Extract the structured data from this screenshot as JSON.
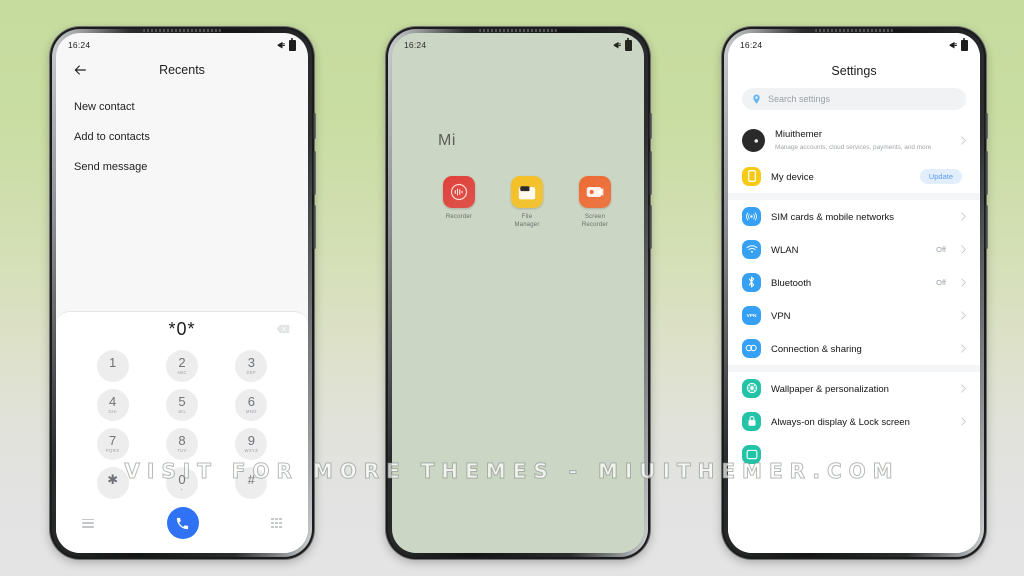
{
  "watermark": "VISIT FOR MORE THEMES - MIUITHEMER.COM",
  "status": {
    "time": "16:24"
  },
  "dialer": {
    "title": "Recents",
    "back_icon": "back-arrow-icon",
    "options": [
      "New contact",
      "Add to contacts",
      "Send message"
    ],
    "number": "*0*",
    "backspace_icon": "backspace-icon",
    "keys": [
      {
        "digit": "1",
        "letters": ""
      },
      {
        "digit": "2",
        "letters": "ABC"
      },
      {
        "digit": "3",
        "letters": "DEF"
      },
      {
        "digit": "4",
        "letters": "GHI"
      },
      {
        "digit": "5",
        "letters": "JKL"
      },
      {
        "digit": "6",
        "letters": "MNO"
      },
      {
        "digit": "7",
        "letters": "PQRS"
      },
      {
        "digit": "8",
        "letters": "TUV"
      },
      {
        "digit": "9",
        "letters": "WXYZ"
      },
      {
        "digit": "✱",
        "letters": ""
      },
      {
        "digit": "0",
        "letters": "+"
      },
      {
        "digit": "#",
        "letters": ""
      }
    ],
    "bottom": {
      "menu_icon": "menu-icon",
      "call_icon": "call-icon",
      "keypad_icon": "keypad-icon"
    },
    "call_color": "#2f72f3"
  },
  "home": {
    "folder_label": "Mi",
    "wallpaper_color": "#ccd6c5",
    "apps": [
      {
        "name": "Recorder",
        "color": "#e0403a"
      },
      {
        "name": "File\nManager",
        "color": "#f6c024"
      },
      {
        "name": "Screen\nRecorder",
        "color": "#ef6a33"
      }
    ]
  },
  "settings": {
    "title": "Settings",
    "search": {
      "placeholder": "Search settings",
      "icon": "location-pin-icon"
    },
    "account": {
      "name": "Miuithemer",
      "desc": "Manage accounts, cloud services, payments, and more",
      "avatar": "user-avatar"
    },
    "device": {
      "label": "My device",
      "badge": "Update",
      "icon": "phone-icon",
      "color": "#f7ca18"
    },
    "groups": [
      {
        "items": [
          {
            "label": "SIM cards & mobile networks",
            "value": "",
            "icon": "sim-tower-icon",
            "color": "#35a0f4"
          },
          {
            "label": "WLAN",
            "value": "Off",
            "icon": "wifi-icon",
            "color": "#35a0f4"
          },
          {
            "label": "Bluetooth",
            "value": "Off",
            "icon": "bluetooth-icon",
            "color": "#35a0f4"
          },
          {
            "label": "VPN",
            "value": "",
            "icon": "vpn-icon",
            "color": "#35a0f4"
          },
          {
            "label": "Connection & sharing",
            "value": "",
            "icon": "link-icon",
            "color": "#35a0f4"
          }
        ]
      },
      {
        "items": [
          {
            "label": "Wallpaper & personalization",
            "value": "",
            "icon": "palette-icon",
            "color": "#22c3a6"
          },
          {
            "label": "Always-on display & Lock screen",
            "value": "",
            "icon": "lock-icon",
            "color": "#22c3a6"
          },
          {
            "label": "",
            "value": "",
            "icon": "display-icon",
            "color": "#22c3a6"
          }
        ]
      }
    ],
    "badge_color": "#e3eefc"
  }
}
